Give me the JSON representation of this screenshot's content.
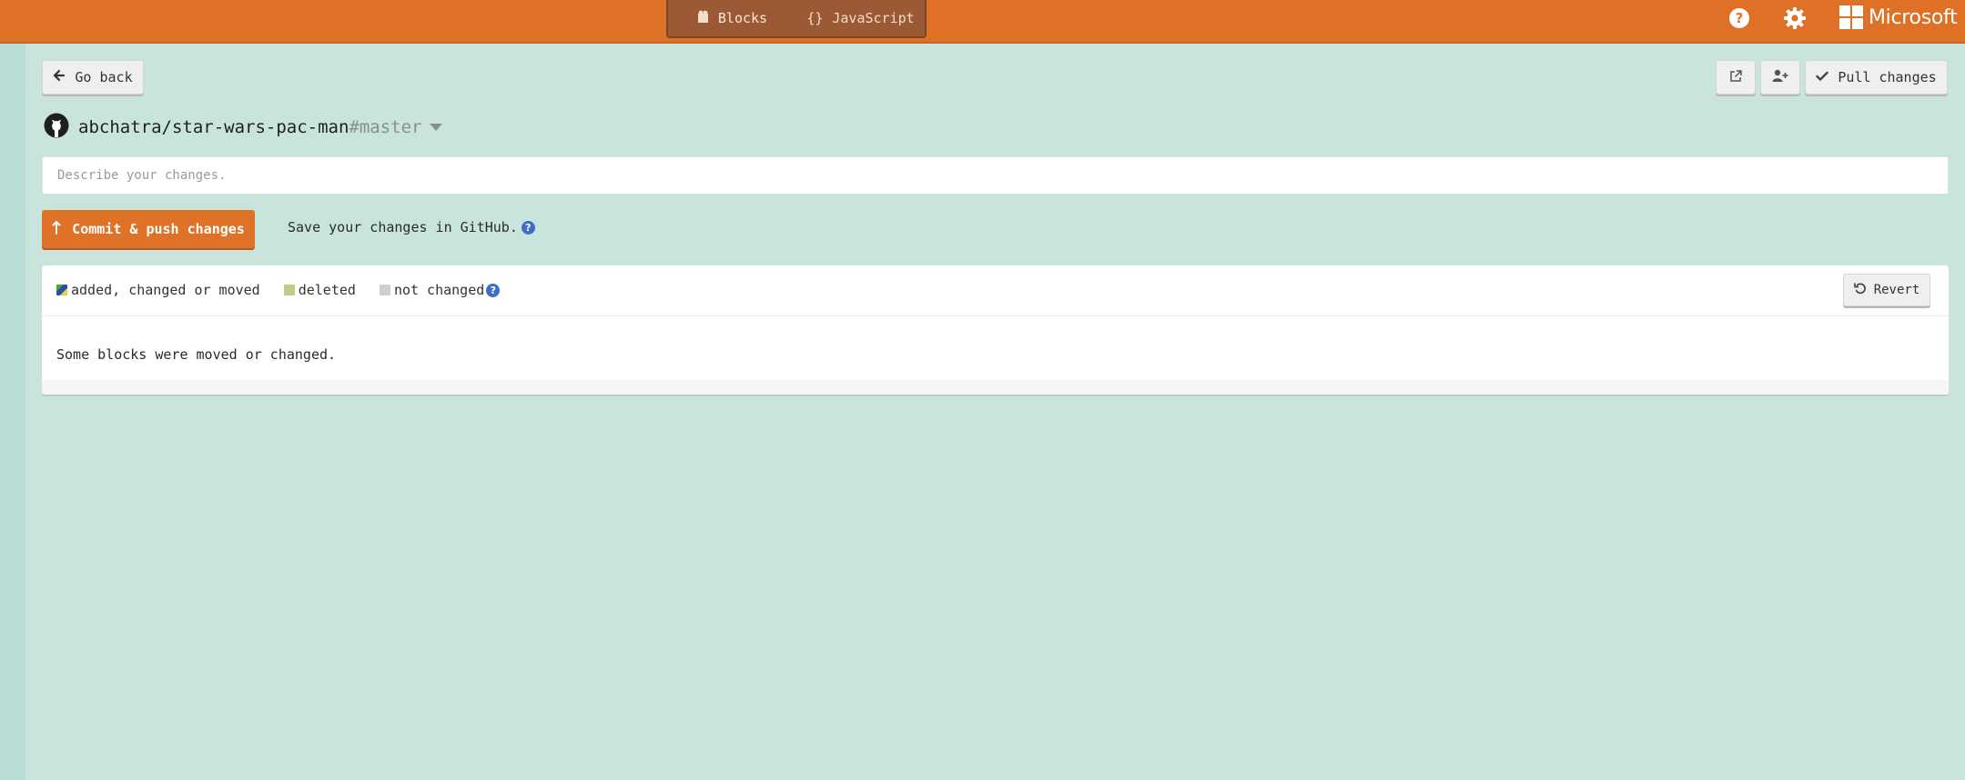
{
  "header": {
    "editor_tabs": [
      {
        "label": "Blocks",
        "icon": "puzzle-icon",
        "active": true
      },
      {
        "label": "JavaScript",
        "icon": "braces-icon",
        "active": false
      }
    ],
    "brand": "Microsoft",
    "colors": {
      "bar": "#de7126",
      "toggle": "#9b5936"
    }
  },
  "toolbar": {
    "go_back_label": "Go back",
    "pull_label": "Pull changes"
  },
  "repo": {
    "name": "abchatra/star-wars-pac-man",
    "branch": "#master"
  },
  "commit": {
    "placeholder": "Describe your changes.",
    "button_label": "Commit & push changes",
    "hint": "Save your changes in GitHub.",
    "button_color": "#e07228"
  },
  "diff": {
    "legend": {
      "added": "added, changed or moved",
      "deleted": "deleted",
      "unchanged": "not changed"
    },
    "revert_label": "Revert",
    "status": "Some blocks were moved or changed."
  }
}
